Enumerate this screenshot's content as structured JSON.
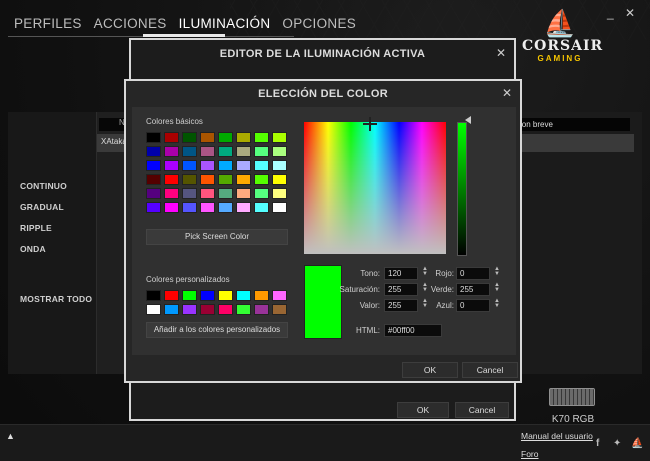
{
  "window": {
    "minimize": "_",
    "close": "✕"
  },
  "nav": {
    "tabs": [
      "PERFILES",
      "ACCIONES",
      "ILUMINACIÓN",
      "OPCIONES"
    ],
    "active": "ILUMINACIÓN"
  },
  "logo": {
    "name": "CORSAIR",
    "sub": "GAMING"
  },
  "sidebar": {
    "items": [
      "CONTINUO",
      "GRADUAL",
      "RIPPLE",
      "ONDA",
      "MOSTRAR TODO"
    ]
  },
  "midpanel": {
    "row1": "N",
    "row2": "XAtaka"
  },
  "rightpanel": {
    "header": "ion breve"
  },
  "device": {
    "name": "K70 RGB"
  },
  "footer": {
    "arrow": "▲",
    "manual": "Manual del usuario",
    "forum": "Foro"
  },
  "editor": {
    "title": "EDITOR DE LA ILUMINACIÓN ACTIVA",
    "ok": "OK",
    "cancel": "Cancel"
  },
  "picker": {
    "title": "ELECCIÓN DEL COLOR",
    "basic_label": "Colores básicos",
    "custom_label": "Colores personalizados",
    "pick_screen": "Pick Screen Color",
    "add_custom": "Añadir a los colores personalizados",
    "ok": "OK",
    "cancel": "Cancel",
    "basic_colors": [
      "#000000",
      "#aa0000",
      "#005500",
      "#aa5500",
      "#00aa00",
      "#aaaa00",
      "#55ff00",
      "#aaff00",
      "#0000aa",
      "#aa00aa",
      "#005585",
      "#aa5585",
      "#00aa7f",
      "#aaaa7f",
      "#55ff7f",
      "#aaff7f",
      "#0000ff",
      "#aa00ff",
      "#0055ff",
      "#aa55ff",
      "#00aaff",
      "#aaaaff",
      "#55ffff",
      "#aaffff",
      "#550000",
      "#ff0000",
      "#555500",
      "#ff5500",
      "#55aa00",
      "#ffaa00",
      "#55ff00",
      "#ffff00",
      "#55007f",
      "#ff007f",
      "#55557f",
      "#ff557f",
      "#55aa7f",
      "#ffaa7f",
      "#55ff7f",
      "#ffff7f",
      "#5500ff",
      "#ff00ff",
      "#5555ff",
      "#ff55ff",
      "#55aaff",
      "#ffaaff",
      "#55ffff",
      "#ffffff"
    ],
    "custom_colors": [
      "#000000",
      "#ff0000",
      "#00ff00",
      "#0000ff",
      "#ffff00",
      "#00ffff",
      "#ff9900",
      "#ff66ff",
      "#ffffff",
      "#0099ff",
      "#9933ff",
      "#990033",
      "#ff0066",
      "#33ff33",
      "#993399",
      "#996633"
    ],
    "selected_color": "#00ff00",
    "fields": {
      "tono": {
        "label": "Tono:",
        "value": "120"
      },
      "saturacion": {
        "label": "Saturación:",
        "value": "255"
      },
      "valor": {
        "label": "Valor:",
        "value": "255"
      },
      "rojo": {
        "label": "Rojo:",
        "value": "0"
      },
      "verde": {
        "label": "Verde:",
        "value": "255"
      },
      "azul": {
        "label": "Azul:",
        "value": "0"
      },
      "html": {
        "label": "HTML:",
        "value": "#00ff00"
      }
    }
  }
}
